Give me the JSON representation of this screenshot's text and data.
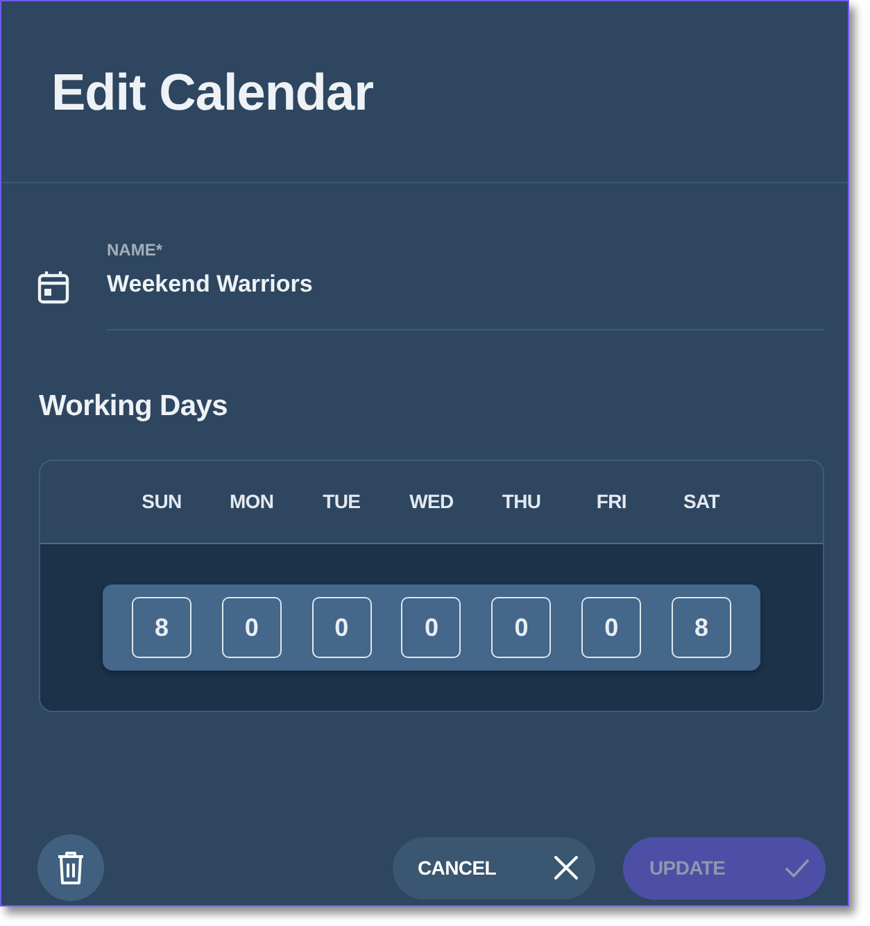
{
  "dialog": {
    "title": "Edit Calendar"
  },
  "name_field": {
    "label": "NAME*",
    "value": "Weekend Warriors"
  },
  "working_days": {
    "title": "Working Days",
    "days": [
      {
        "label": "SUN",
        "hours": "8"
      },
      {
        "label": "MON",
        "hours": "0"
      },
      {
        "label": "TUE",
        "hours": "0"
      },
      {
        "label": "WED",
        "hours": "0"
      },
      {
        "label": "THU",
        "hours": "0"
      },
      {
        "label": "FRI",
        "hours": "0"
      },
      {
        "label": "SAT",
        "hours": "8"
      }
    ]
  },
  "actions": [
    {
      "kind": "delete"
    },
    {
      "kind": "cancel",
      "label": "CANCEL",
      "disabled": false
    },
    {
      "kind": "update",
      "label": "UPDATE",
      "disabled": true
    }
  ]
}
